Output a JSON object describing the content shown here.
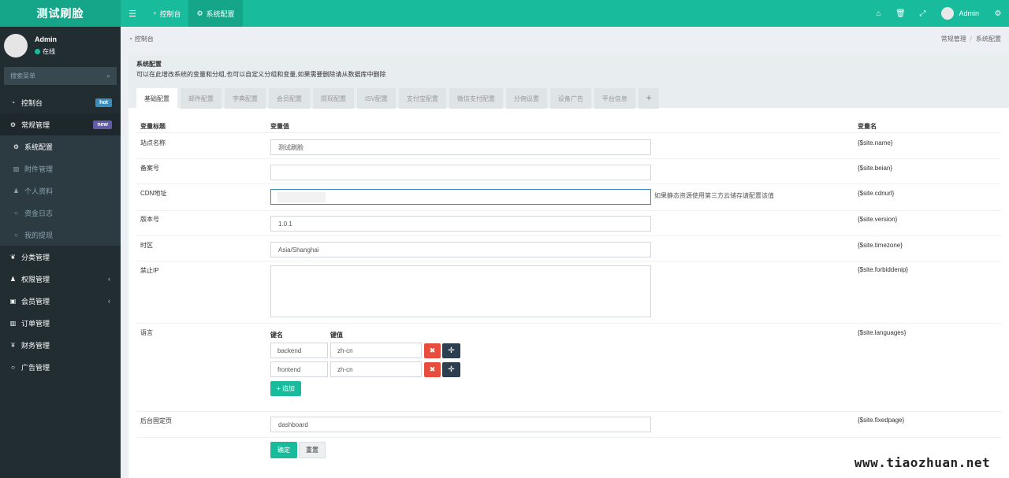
{
  "app": {
    "logo": "测试刷脸"
  },
  "topnav": {
    "items": [
      {
        "label": "控制台",
        "icon": "dashboard-icon"
      },
      {
        "label": "系统配置",
        "icon": "gear-icon"
      }
    ],
    "right_icons": [
      "home-icon",
      "trash-icon",
      "fullscreen-icon"
    ],
    "user": "Admin"
  },
  "sidebar": {
    "user_name": "Admin",
    "user_status": "在线",
    "search_placeholder": "搜索菜单",
    "items": [
      {
        "label": "控制台",
        "icon": "dashboard-icon",
        "badge": "hot"
      },
      {
        "label": "常规管理",
        "icon": "cogs-icon",
        "badge": "new"
      },
      {
        "label": "系统配置",
        "icon": "gear-icon"
      },
      {
        "label": "附件管理",
        "icon": "file-image-icon"
      },
      {
        "label": "个人资料",
        "icon": "user-icon"
      },
      {
        "label": "资金日志",
        "icon": "circle-icon"
      },
      {
        "label": "我的提现",
        "icon": "circle-icon"
      },
      {
        "label": "分类管理",
        "icon": "leaf-icon"
      },
      {
        "label": "权限管理",
        "icon": "group-icon"
      },
      {
        "label": "会员管理",
        "icon": "user-card-icon"
      },
      {
        "label": "订单管理",
        "icon": "bar-chart-icon"
      },
      {
        "label": "财务管理",
        "icon": "yen-icon"
      },
      {
        "label": "广告管理",
        "icon": "circle-icon"
      }
    ]
  },
  "breadcrumb": {
    "left": "控制台",
    "right_1": "常规管理",
    "right_2": "系统配置"
  },
  "panel": {
    "title": "系统配置",
    "description": "可以在此增改系统的变量和分组,也可以自定义分组和变量,如果需要删除请从数据库中删除",
    "tabs": [
      "基础配置",
      "邮件配置",
      "字典配置",
      "会员配置",
      "提现配置",
      "ISV配置",
      "支付宝配置",
      "微信支付配置",
      "分佣设置",
      "设备广告",
      "平台信息",
      "+"
    ]
  },
  "table": {
    "headers": {
      "title": "变量标题",
      "value": "变量值",
      "name": "变量名"
    },
    "rows": [
      {
        "label": "站点名称",
        "value": "测试刷脸",
        "name": "{$site.name}"
      },
      {
        "label": "备案号",
        "value": "",
        "name": "{$site.beian}"
      },
      {
        "label": "CDN地址",
        "value": "",
        "help": "如果静态资源使用第三方云储存请配置该值",
        "name": "{$site.cdnurl}"
      },
      {
        "label": "版本号",
        "value": "1.0.1",
        "name": "{$site.version}"
      },
      {
        "label": "时区",
        "value": "Asia/Shanghai",
        "name": "{$site.timezone}"
      },
      {
        "label": "禁止IP",
        "value": "",
        "name": "{$site.forbiddenip}"
      },
      {
        "label": "语言",
        "name": "{$site.languages}"
      },
      {
        "label": "后台固定页",
        "value": "dashboard",
        "name": "{$site.fixedpage}"
      }
    ],
    "languages": {
      "key_header": "键名",
      "val_header": "键值",
      "pairs": [
        {
          "key": "backend",
          "value": "zh-cn"
        },
        {
          "key": "frontend",
          "value": "zh-cn"
        }
      ],
      "add_label": "追加"
    }
  },
  "actions": {
    "ok": "确定",
    "reset": "重置"
  },
  "watermark": "www.tiaozhuan.net"
}
